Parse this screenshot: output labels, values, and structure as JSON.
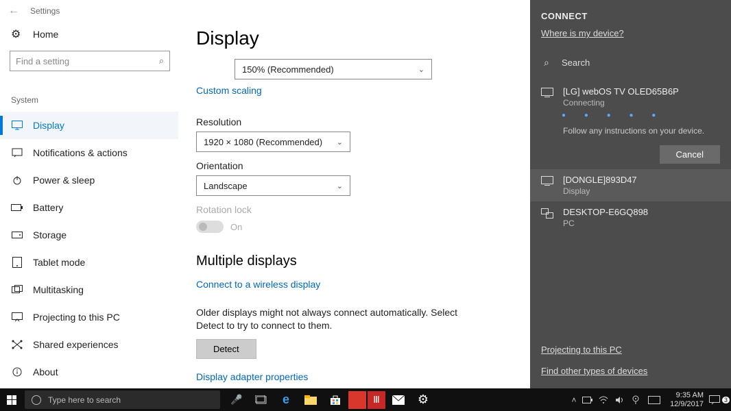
{
  "window": {
    "title": "Settings",
    "home": "Home",
    "search_placeholder": "Find a setting"
  },
  "sidebar": {
    "section": "System",
    "items": [
      {
        "label": "Display",
        "icon": "display-icon"
      },
      {
        "label": "Notifications & actions",
        "icon": "notifications-icon"
      },
      {
        "label": "Power & sleep",
        "icon": "power-icon"
      },
      {
        "label": "Battery",
        "icon": "battery-icon"
      },
      {
        "label": "Storage",
        "icon": "storage-icon"
      },
      {
        "label": "Tablet mode",
        "icon": "tablet-icon"
      },
      {
        "label": "Multitasking",
        "icon": "multitasking-icon"
      },
      {
        "label": "Projecting to this PC",
        "icon": "projecting-icon"
      },
      {
        "label": "Shared experiences",
        "icon": "shared-icon"
      },
      {
        "label": "About",
        "icon": "about-icon"
      }
    ],
    "active_index": 0
  },
  "display": {
    "heading": "Display",
    "scale_value": "150% (Recommended)",
    "custom_scaling_link": "Custom scaling",
    "resolution_label": "Resolution",
    "resolution_value": "1920 × 1080 (Recommended)",
    "orientation_label": "Orientation",
    "orientation_value": "Landscape",
    "rotation_lock_label": "Rotation lock",
    "rotation_lock_state": "On",
    "multiple_heading": "Multiple displays",
    "wireless_link": "Connect to a wireless display",
    "detect_help": "Older displays might not always connect automatically. Select Detect to try to connect to them.",
    "detect_button": "Detect",
    "adapter_link": "Display adapter properties"
  },
  "connect": {
    "title": "CONNECT",
    "where_link": "Where is my device?",
    "search_label": "Search",
    "devices": [
      {
        "name": "[LG] webOS TV OLED65B6P",
        "status": "Connecting",
        "instructions": "Follow any instructions on your device.",
        "type": "display"
      },
      {
        "name": "[DONGLE]893D47",
        "status": "Display",
        "type": "display"
      },
      {
        "name": "DESKTOP-E6GQ898",
        "status": "PC",
        "type": "pc"
      }
    ],
    "cancel": "Cancel",
    "projecting_link": "Projecting to this PC",
    "find_other_link": "Find other types of devices"
  },
  "taskbar": {
    "search_placeholder": "Type here to search",
    "time": "9:35 AM",
    "date": "12/9/2017",
    "notification_count": "3"
  }
}
